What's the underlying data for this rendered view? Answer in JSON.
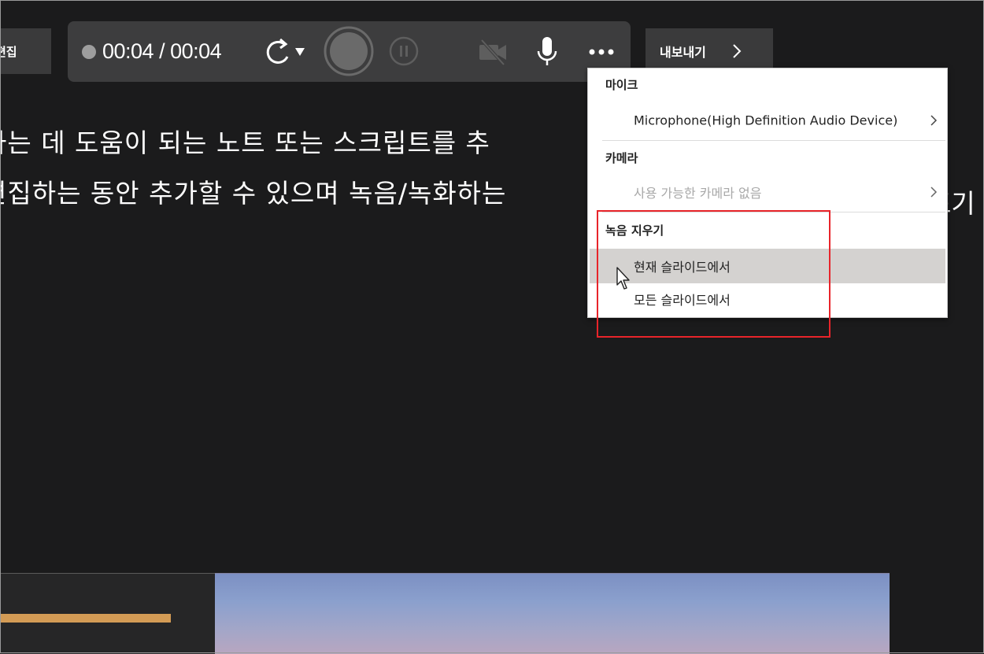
{
  "toolbar": {
    "edit_label": "편집",
    "timer": "00:04 / 00:04",
    "export_label": "내보내기"
  },
  "notes": {
    "line1": "하는 데 도움이 되는 노트 또는 스크립트를 추",
    "line2": "편집하는 동안 추가할 수 있으며 녹음/녹화하는",
    "line2_tail": "표기"
  },
  "menu": {
    "mic_section": "마이크",
    "mic_device": "Microphone(High Definition Audio Device)",
    "camera_section": "카메라",
    "camera_none": "사용 가능한 카메라 없음",
    "clear_section": "녹음 지우기",
    "clear_current": "현재 슬라이드에서",
    "clear_all": "모든 슬라이드에서"
  },
  "colors": {
    "background": "#1b1b1c",
    "control_bar": "#3d3d3e",
    "highlight_box": "#e8242a",
    "slide_accent": "#d39b55"
  },
  "icons": [
    "record-dot-icon",
    "retake-icon",
    "dropdown-arrow-icon",
    "record-icon",
    "pause-icon",
    "camera-off-icon",
    "microphone-icon",
    "more-options-icon",
    "chevron-right-icon",
    "mouse-cursor-icon"
  ]
}
